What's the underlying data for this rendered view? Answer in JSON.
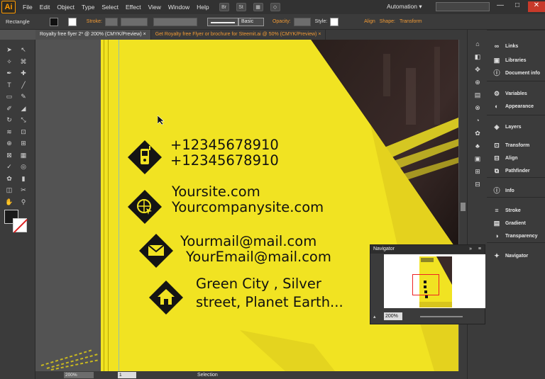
{
  "app": {
    "logo": "Ai"
  },
  "menu": {
    "items": [
      "File",
      "Edit",
      "Object",
      "Type",
      "Select",
      "Effect",
      "View",
      "Window",
      "Help"
    ],
    "br_label": "Br",
    "st_label": "St"
  },
  "workspace": {
    "label": "Automation",
    "arrow": "▾"
  },
  "window_controls": {
    "minimize": "—",
    "maximize": "□",
    "close": "✕"
  },
  "control_bar": {
    "object_type": "Rectangle",
    "stroke_label": "Stroke:",
    "brush_label": "Basic",
    "opacity_label": "Opacity:",
    "style_label": "Style:",
    "align_label": "Align",
    "shape_label": "Shape:",
    "transform_label": "Transform"
  },
  "tabs": [
    {
      "label": "Royalty free flyer 2* @ 200% (CMYK/Preview)",
      "close": "×"
    },
    {
      "label": "Get Royalty free Flyer or brochure for Steemit.ai @ 50% (CMYK/Preview)",
      "close": "×"
    }
  ],
  "tools": {
    "icons": [
      "selection-icon",
      "direct-selection-icon",
      "magic-wand-icon",
      "lasso-icon",
      "pen-icon",
      "add-anchor-icon",
      "type-icon",
      "line-icon",
      "rectangle-icon",
      "paintbrush-icon",
      "pencil-icon",
      "eraser-icon",
      "rotate-icon",
      "scale-icon",
      "width-icon",
      "free-transform-icon",
      "shape-builder-icon",
      "perspective-icon",
      "mesh-icon",
      "gradient-icon",
      "eyedropper-icon",
      "blend-icon",
      "symbol-sprayer-icon",
      "column-graph-icon",
      "artboard-icon",
      "slice-icon",
      "hand-icon",
      "zoom-icon"
    ],
    "glyphs": [
      "➤",
      "↖",
      "✧",
      "⌘",
      "✒",
      "✚",
      "T",
      "╱",
      "▭",
      "✎",
      "✐",
      "◢",
      "↻",
      "⤡",
      "≋",
      "⊡",
      "⊕",
      "⊞",
      "⊠",
      "▦",
      "✓",
      "◎",
      "✿",
      "▮",
      "◫",
      "✂",
      "✋",
      "⚲"
    ]
  },
  "contacts": [
    {
      "lines": [
        "+12345678910",
        "+12345678910"
      ],
      "icon": "phone-icon"
    },
    {
      "lines": [
        "Yoursite.com",
        "Yourcompanysite.com"
      ],
      "icon": "globe-cursor-icon"
    },
    {
      "lines": [
        "Yourmail@mail.com",
        "YourEmail@mail.com"
      ],
      "icon": "envelope-icon"
    },
    {
      "lines": [
        "Green City , Silver",
        "street, Planet Earth..."
      ],
      "icon": "home-icon"
    }
  ],
  "dock": {
    "items": [
      {
        "label": "Links",
        "icon": "links-icon",
        "glyph": "∞"
      },
      {
        "label": "Libraries",
        "icon": "libraries-icon",
        "glyph": "▣"
      },
      {
        "label": "Document info",
        "icon": "document-info-icon",
        "glyph": "ⓘ"
      },
      {
        "label": "Variables",
        "icon": "variables-icon",
        "glyph": "⚙"
      },
      {
        "label": "Appearance",
        "icon": "appearance-icon",
        "glyph": "◐"
      },
      {
        "label": "Layers",
        "icon": "layers-icon",
        "glyph": "◈"
      },
      {
        "label": "Transform",
        "icon": "transform-icon",
        "glyph": "⊡"
      },
      {
        "label": "Align",
        "icon": "align-icon",
        "glyph": "⊟"
      },
      {
        "label": "Pathfinder",
        "icon": "pathfinder-icon",
        "glyph": "⧉"
      },
      {
        "label": "Info",
        "icon": "info-icon",
        "glyph": "ⓘ"
      },
      {
        "label": "Stroke",
        "icon": "stroke-icon",
        "glyph": "≡"
      },
      {
        "label": "Gradient",
        "icon": "gradient-icon",
        "glyph": "▤"
      },
      {
        "label": "Transparency",
        "icon": "transparency-icon",
        "glyph": "◑"
      },
      {
        "label": "Navigator",
        "icon": "navigator-icon",
        "glyph": "✦"
      }
    ]
  },
  "navigator": {
    "title": "Navigator",
    "zoom": "200%",
    "menu": "≡",
    "collapse": "»"
  },
  "status": {
    "zoom": "200%",
    "page": "1",
    "mode": "Selection"
  },
  "colors": {
    "accent": "#f19a35",
    "artboard_yellow": "#f1e322",
    "diamond_black": "#141414"
  }
}
